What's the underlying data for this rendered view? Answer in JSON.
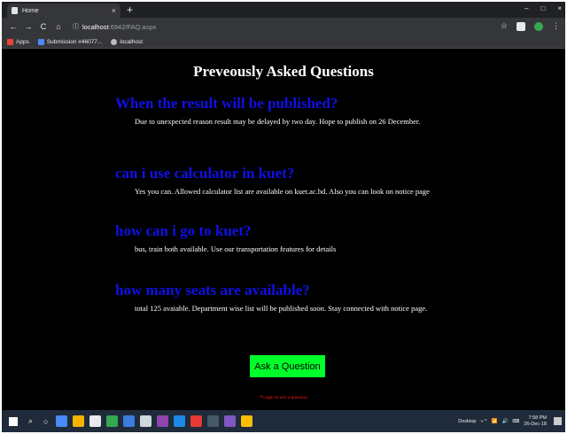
{
  "browser": {
    "tab_title": "Home",
    "tab_close": "×",
    "new_tab": "+",
    "window_controls": [
      "–",
      "□",
      "×"
    ],
    "nav": {
      "back": "←",
      "forward": "→",
      "reload": "C",
      "home": "⌂"
    },
    "url_host": "localhost",
    "url_path": ":6942/FAQ.aspx",
    "star": "☆",
    "menu": "⋮",
    "bookmarks": [
      {
        "label": "Apps",
        "icon": "apps-icon"
      },
      {
        "label": "Submission #46077...",
        "icon": "bookmark-icon"
      },
      {
        "label": "localhost",
        "icon": "globe-icon"
      }
    ]
  },
  "page": {
    "title": "Preveously Asked Questions",
    "faqs": [
      {
        "question": "When the result will be published?",
        "answer": "Due to unexpected reason result may be delayed by two day. Hope to publish on 26 December."
      },
      {
        "question": "can i use calculator in kuet?",
        "answer": "Yes you can. Allowed calculator list are available on kuet.ac.bd. Also you can look on notice page"
      },
      {
        "question": "how can i go to kuet?",
        "answer": "bus, train both available. Use our transportation features for details"
      },
      {
        "question": "how many seats are available?",
        "answer": "total 125 avaiable. Department wise list will be published soon. Stay connected with notice page."
      }
    ],
    "ask_button": "Ask a Question",
    "login_note": "*Login to ask a question"
  },
  "taskbar": {
    "desktop_label": "Desktop",
    "tray_arrows": "» ^",
    "time": "7:58 PM",
    "date": "26-Dec-18",
    "apps": [
      {
        "icon": "file-explorer-icon",
        "color": "#4a8af4"
      },
      {
        "icon": "store-icon",
        "color": "#f4b400"
      },
      {
        "icon": "bag-icon",
        "color": "#e8eaed"
      },
      {
        "icon": "app-icon",
        "color": "#34a853"
      },
      {
        "icon": "edge-icon",
        "color": "#3b7ddd"
      },
      {
        "icon": "mail-icon",
        "color": "#cfd8dc"
      },
      {
        "icon": "visual-studio-icon",
        "color": "#8e44ad"
      },
      {
        "icon": "app2-icon",
        "color": "#1e88e5"
      },
      {
        "icon": "opera-icon",
        "color": "#e53935"
      },
      {
        "icon": "terminal-icon",
        "color": "#455a64"
      },
      {
        "icon": "vs-code-icon",
        "color": "#7e57c2"
      },
      {
        "icon": "chrome-icon",
        "color": "#fbbc05"
      }
    ]
  }
}
